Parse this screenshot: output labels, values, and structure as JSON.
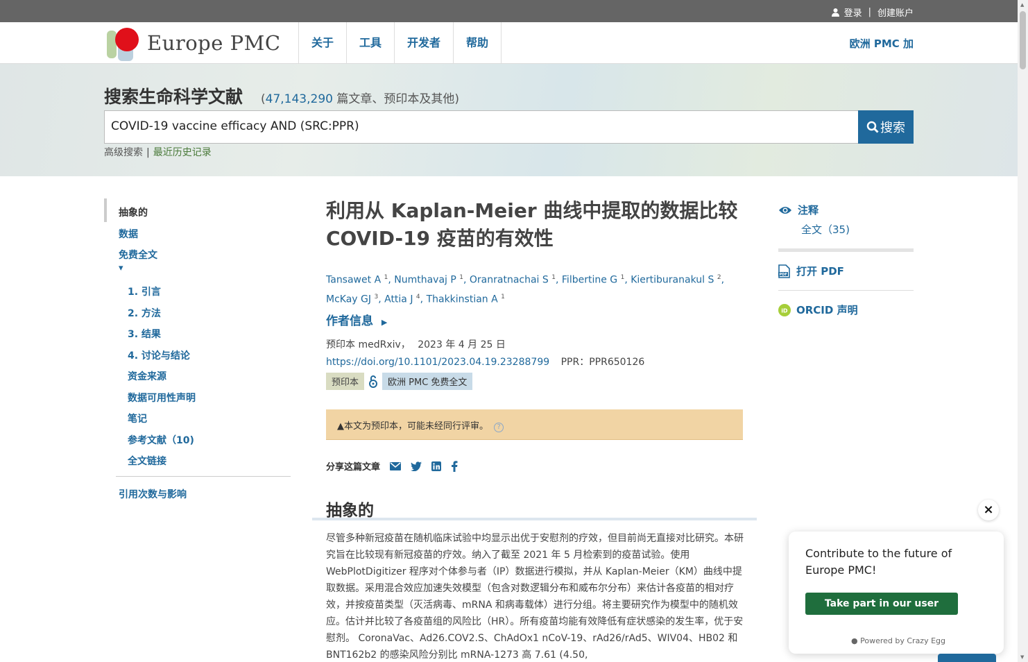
{
  "topbar": {
    "login": "登录",
    "separator": "|",
    "create": "创建账户"
  },
  "logo": {
    "name": "Europe PMC"
  },
  "nav": [
    "关于",
    "工具",
    "开发者",
    "帮助"
  ],
  "plus": "欧洲 PMC 加",
  "search": {
    "heading": "搜索生命科学文献",
    "count_open": "(",
    "count_number": "47,143,290",
    "count_rest": " 篇文章、预印本及其他)",
    "query": "COVID-19 vaccine efficacy AND (SRC:PPR)",
    "button": "搜索",
    "advanced": "高级搜索",
    "separator": "|",
    "history": "最近历史记录"
  },
  "sidenav": {
    "abstract": "抽象的",
    "data": "数据",
    "fulltext": "免费全文",
    "caret": "▾",
    "items": [
      "1. 引言",
      "2. 方法",
      "3. 结果",
      "4. 讨论与结论",
      "资金来源",
      "数据可用性声明",
      "笔记",
      "参考文献（10)",
      "全文链接"
    ],
    "citations": "引用次数与影响"
  },
  "article": {
    "title": "利用从 Kaplan-Meier 曲线中提取的数据比较 COVID-19 疫苗的有效性",
    "authors": [
      {
        "name": "Tansawet A",
        "sup": "1"
      },
      {
        "name": "Numthavaj P",
        "sup": "1"
      },
      {
        "name": "Oranratnachai S",
        "sup": "1"
      },
      {
        "name": "Filbertine G",
        "sup": "1"
      },
      {
        "name": "Kiertiburanakul S",
        "sup": "2"
      },
      {
        "name": "McKay GJ",
        "sup": "3"
      },
      {
        "name": "Attia J",
        "sup": "4"
      },
      {
        "name": "Thakkinstian A",
        "sup": "1"
      }
    ],
    "author_info": "作者信息",
    "meta_source": "预印本 medRxiv，",
    "meta_date": "2023 年 4 月 25 日",
    "doi": "https://doi.org/10.1101/2023.04.19.23288799",
    "ppr": "PPR：PPR650126",
    "tag_preprint": "预印本",
    "tag_free": "欧洲 PMC 免费全文",
    "notice": "本文为预印本，可能未经同行评审。",
    "notice_help": "?",
    "share_label": "分享这篇文章",
    "abstract_heading": "抽象的",
    "abstract_text": "尽管多种新冠疫苗在随机临床试验中均显示出优于安慰剂的疗效，但目前尚无直接对比研究。本研究旨在比较现有新冠疫苗的疗效。纳入了截至 2021 年 5 月检索到的疫苗试验。使用 WebPlotDigitizer 程序对个体参与者（IP）数据进行模拟，并从 Kaplan-Meier（KM）曲线中提取数据。采用混合效应加速失效模型（包含对数逻辑分布和威布尔分布）来估计各疫苗的相对疗效，并按疫苗类型（灭活病毒、mRNA 和病毒载体）进行分组。将主要研究作为模型中的随机效应。估计并比较了各疫苗组的风险比（HR）。所有疫苗均能有效降低有症状感染的发生率，优于安慰剂。 CoronaVac、Ad26.COV2.S、ChAdOx1 nCoV-19、rAd26/rAd5、WIV04、HB02 和 BNT162b2 的感染风险分别比 mRNA-1273 高 7.61 (4.50,"
  },
  "right": {
    "annotations": "注释",
    "fulltext_count": "全文（35)",
    "pdf": "打开 PDF",
    "orcid": "ORCID 声明"
  },
  "survey": {
    "close": "×",
    "message": "Contribute to the future of Europe PMC!",
    "button": "Take part in our user survey",
    "powered": "Powered by Crazy Egg"
  },
  "colors": {
    "link": "#20699c",
    "survey_button": "#1f6e3d",
    "notice": "#f1d4a4"
  }
}
